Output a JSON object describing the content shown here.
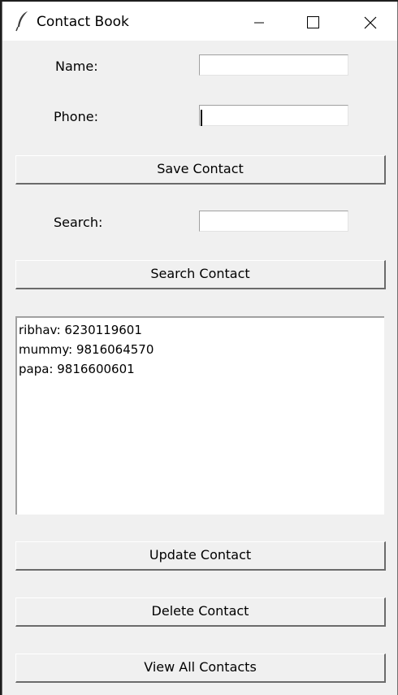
{
  "window": {
    "title": "Contact Book"
  },
  "form": {
    "name_label": "Name:",
    "name_value": "",
    "phone_label": "Phone:",
    "phone_value": "",
    "save_label": "Save Contact",
    "search_label": "Search:",
    "search_value": "",
    "search_button_label": "Search Contact"
  },
  "contacts": [
    "ribhav: 6230119601",
    "mummy: 9816064570",
    "papa: 9816600601"
  ],
  "actions": {
    "update_label": "Update Contact",
    "delete_label": "Delete Contact",
    "view_all_label": "View All Contacts"
  },
  "icons": {
    "app": "feather-icon",
    "minimize": "minimize-icon",
    "maximize": "maximize-icon",
    "close": "close-icon"
  }
}
